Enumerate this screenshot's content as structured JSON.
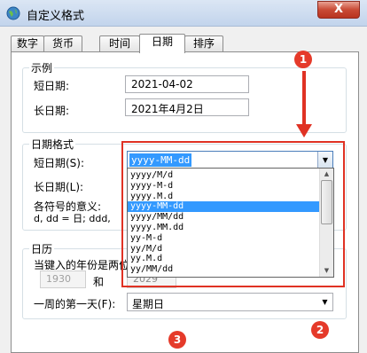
{
  "window": {
    "title": "自定义格式",
    "close_label": "X"
  },
  "tabs": [
    {
      "label": "数字"
    },
    {
      "label": "货币"
    },
    {
      "label": "时间"
    },
    {
      "label": "日期"
    },
    {
      "label": "排序"
    }
  ],
  "example": {
    "legend": "示例",
    "short_label": "短日期:",
    "short_value": "2021-04-02",
    "long_label": "长日期:",
    "long_value": "2021年4月2日"
  },
  "date_format": {
    "legend": "日期格式",
    "short_label": "短日期(S):",
    "short_value": "yyyy-MM-dd",
    "long_label": "长日期(L):",
    "symbols_label": "各符号的意义:",
    "symbols_text": "d, dd = 日;  ddd,",
    "options": [
      "yyyy/M/d",
      "yyyy-M-d",
      "yyyy.M.d",
      "yyyy-MM-dd",
      "yyyy/MM/dd",
      "yyyy.MM.dd",
      "yy-M-d",
      "yy/M/d",
      "yy.M.d",
      "yy/MM/dd"
    ],
    "highlighted_index": 3
  },
  "calendar": {
    "legend": "日历",
    "two_digit_label": "当键入的年份是两位",
    "year_from": "1930",
    "and_label": "和",
    "year_to": "2029",
    "first_day_label": "一周的第一天(F):",
    "first_day_value": "星期日"
  },
  "annotations": {
    "marker_1": "1",
    "marker_2": "2",
    "marker_3": "3"
  },
  "colors": {
    "annotation_red": "#e03224",
    "selection_blue": "#3399ff"
  }
}
